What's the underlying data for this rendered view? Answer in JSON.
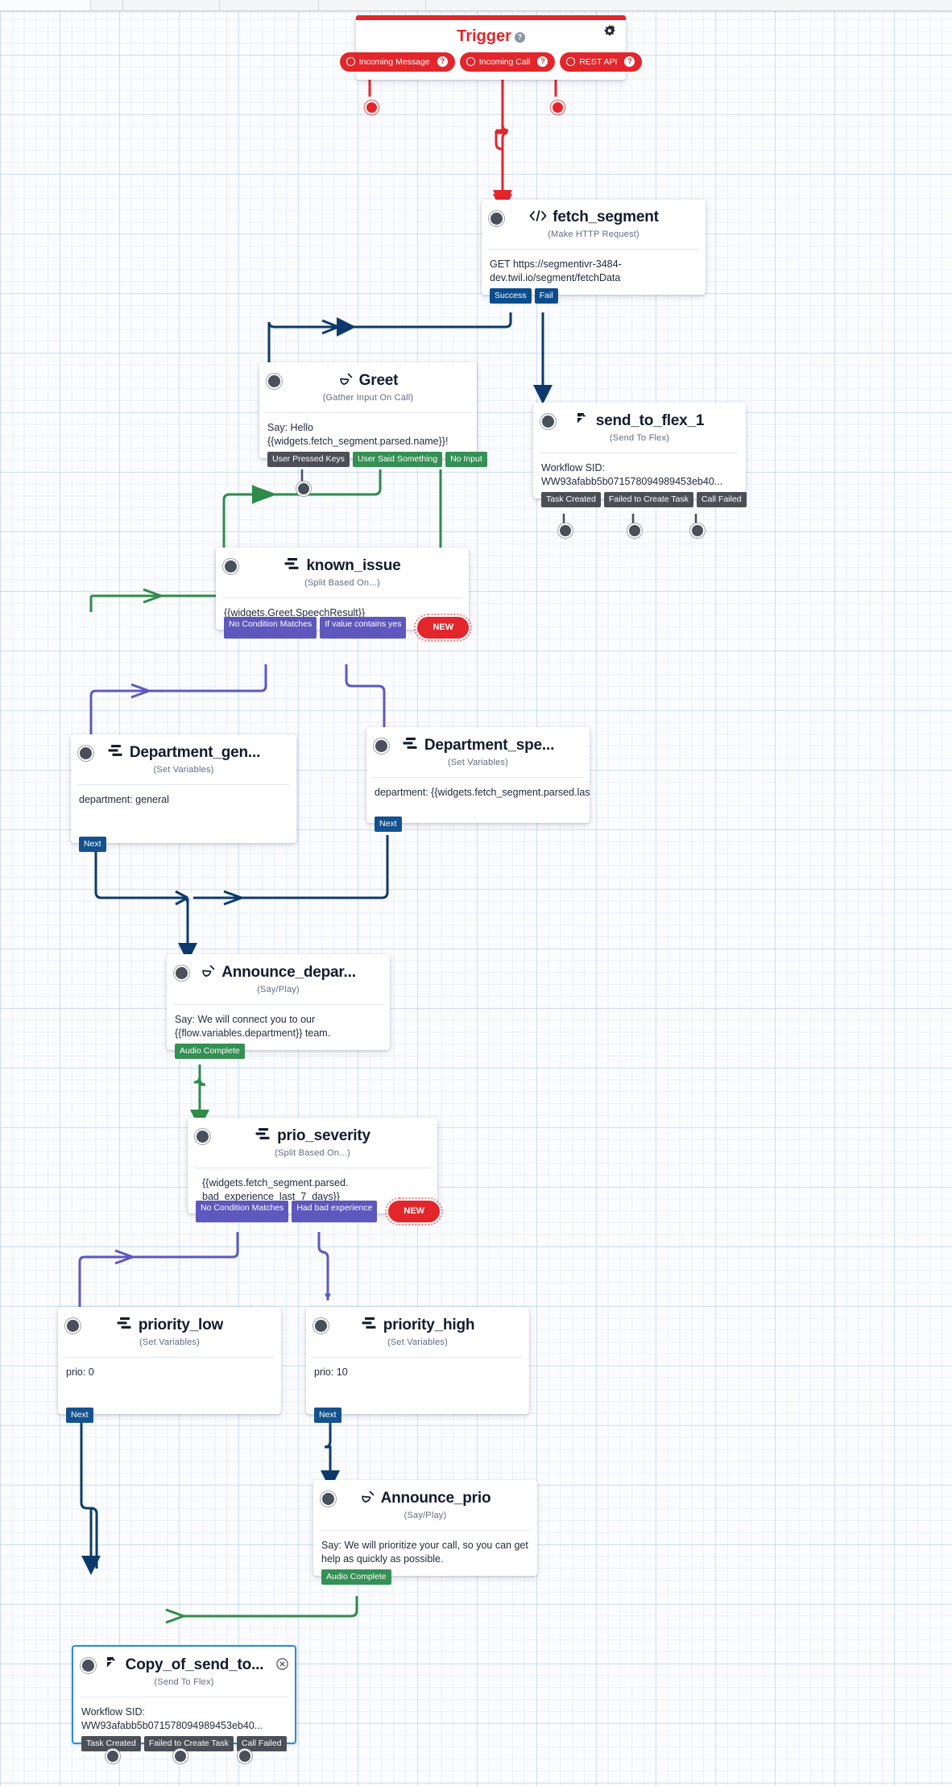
{
  "canvas": {
    "background_color": "#fbfcfe",
    "grid_color": "#96b4e1"
  },
  "trigger": {
    "title": "Trigger",
    "help": "?",
    "gear_icon": "gear-icon",
    "triggers": [
      {
        "label": "Incoming Message",
        "help": "?"
      },
      {
        "label": "Incoming Call",
        "help": "?"
      },
      {
        "label": "REST API",
        "help": "?"
      }
    ]
  },
  "widgets": [
    {
      "id": "fetch_segment",
      "title": "fetch_segment",
      "icon": "code-brackets-icon",
      "subtitle": "(Make HTTP Request)",
      "body": "GET https://segmentivr-3484-dev.twil.io/segment/fetchData",
      "outputs": [
        {
          "label": "Success",
          "style": "blue"
        },
        {
          "label": "Fail",
          "style": "blue"
        }
      ]
    },
    {
      "id": "Greet",
      "title": "Greet",
      "icon": "phone-icon",
      "subtitle": "(Gather Input On Call)",
      "body": "Say: Hello {{widgets.fetch_segment.parsed.name}}!",
      "outputs": [
        {
          "label": "User Pressed Keys",
          "style": "dark"
        },
        {
          "label": "User Said Something",
          "style": "green"
        },
        {
          "label": "No Input",
          "style": "green"
        }
      ]
    },
    {
      "id": "send_to_flex_1",
      "title": "send_to_flex_1",
      "icon": "flex-icon",
      "subtitle": "(Send To Flex)",
      "body": "Workflow SID: WW93afabb5b071578094989453eb40...",
      "outputs": [
        {
          "label": "Task Created",
          "style": "dark"
        },
        {
          "label": "Failed to Create Task",
          "style": "dark"
        },
        {
          "label": "Call Failed",
          "style": "dark"
        }
      ]
    },
    {
      "id": "known_issue",
      "title": "known_issue",
      "icon": "split-icon",
      "subtitle": "(Split Based On...)",
      "body": "{{widgets.Greet.SpeechResult}}",
      "outputs": [
        {
          "label": "No Condition Matches",
          "style": "purple"
        },
        {
          "label": "If value contains yes",
          "style": "purple"
        }
      ],
      "new_label": "NEW"
    },
    {
      "id": "Department_general",
      "title": "Department_gen...",
      "icon": "split-icon",
      "subtitle": "(Set Variables)",
      "body": "department: general",
      "outputs": [
        {
          "label": "Next",
          "style": "navy"
        }
      ]
    },
    {
      "id": "Department_specific",
      "title": "Department_spe...",
      "icon": "split-icon",
      "subtitle": "(Set Variables)",
      "body": "department: {{widgets.fetch_segment.parsed.last_error_d",
      "outputs": [
        {
          "label": "Next",
          "style": "navy"
        }
      ]
    },
    {
      "id": "Announce_department",
      "title": "Announce_depar...",
      "icon": "phone-icon",
      "subtitle": "(Say/Play)",
      "body": "Say: We will connect you to our {{flow.variables.department}} team.",
      "outputs": [
        {
          "label": "Audio Complete",
          "style": "green"
        }
      ]
    },
    {
      "id": "prio_severity",
      "title": "prio_severity",
      "icon": "split-icon",
      "subtitle": "(Split Based On...)",
      "body": "{{widgets.fetch_segment.parsed.\nbad_experience_last_7_days}}",
      "outputs": [
        {
          "label": "No Condition Matches",
          "style": "purple"
        },
        {
          "label": "Had bad experience",
          "style": "purple"
        }
      ],
      "new_label": "NEW"
    },
    {
      "id": "priority_low",
      "title": "priority_low",
      "icon": "split-icon",
      "subtitle": "(Set Variables)",
      "body": "prio: 0",
      "outputs": [
        {
          "label": "Next",
          "style": "navy"
        }
      ]
    },
    {
      "id": "priority_high",
      "title": "priority_high",
      "icon": "split-icon",
      "subtitle": "(Set Variables)",
      "body": "prio: 10",
      "outputs": [
        {
          "label": "Next",
          "style": "navy"
        }
      ]
    },
    {
      "id": "Announce_prio",
      "title": "Announce_prio",
      "icon": "phone-icon",
      "subtitle": "(Say/Play)",
      "body": "Say: We will prioritize your call, so you can get help as quickly as possible.",
      "outputs": [
        {
          "label": "Audio Complete",
          "style": "green"
        }
      ]
    },
    {
      "id": "Copy_of_send_to_flex",
      "title": "Copy_of_send_to...",
      "icon": "flex-icon",
      "subtitle": "(Send To Flex)",
      "body": "Workflow SID: WW93afabb5b071578094989453eb40...",
      "selected": true,
      "close_icon": "close-icon",
      "outputs": [
        {
          "label": "Task Created",
          "style": "dark"
        },
        {
          "label": "Failed to Create Task",
          "style": "dark"
        },
        {
          "label": "Call Failed",
          "style": "dark"
        }
      ]
    }
  ],
  "colors": {
    "trigger_red": "#e2262b",
    "connector_green": "#2e8b49",
    "connector_navy": "#0d3a6b",
    "connector_purple": "#5e58be",
    "selection_blue": "#268ed4"
  }
}
